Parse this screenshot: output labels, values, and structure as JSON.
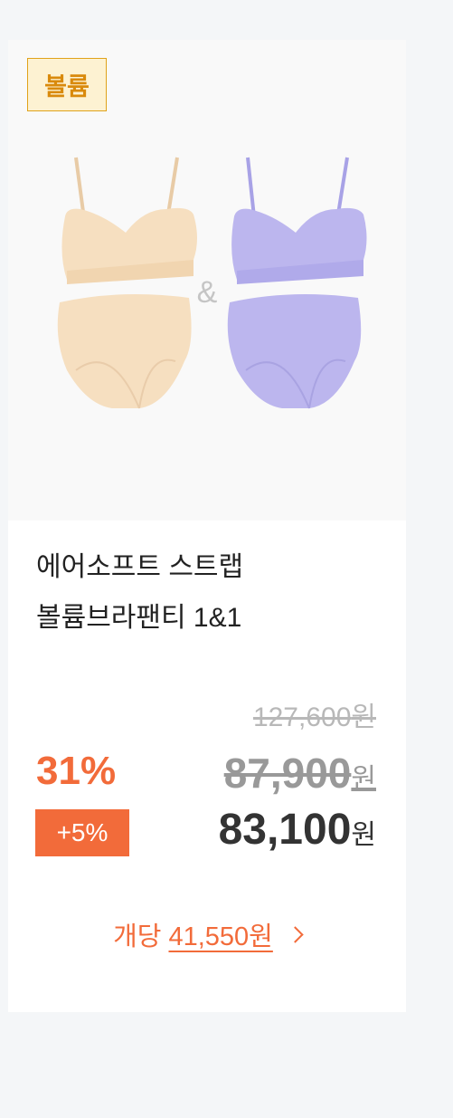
{
  "product": {
    "badge": "볼륨",
    "title_line1": "에어소프트 스트랩",
    "title_line2": "볼륨브라팬티 1&1",
    "image_joiner": "&",
    "original_price": "127,600",
    "discount_rate": "31%",
    "sale_price": "87,900",
    "extra_discount": "+5%",
    "final_price": "83,100",
    "currency": "원",
    "unit_price_label": "개당",
    "unit_price": "41,550원"
  },
  "colors": {
    "accent": "#f26b3a",
    "badge_border": "#e0a21a",
    "badge_bg": "#fdf2d2",
    "beige_set": "#f6dfc0",
    "lavender_set": "#bcb6ee"
  },
  "icons": {
    "unit_price_arrow": "chevron-right-icon"
  }
}
